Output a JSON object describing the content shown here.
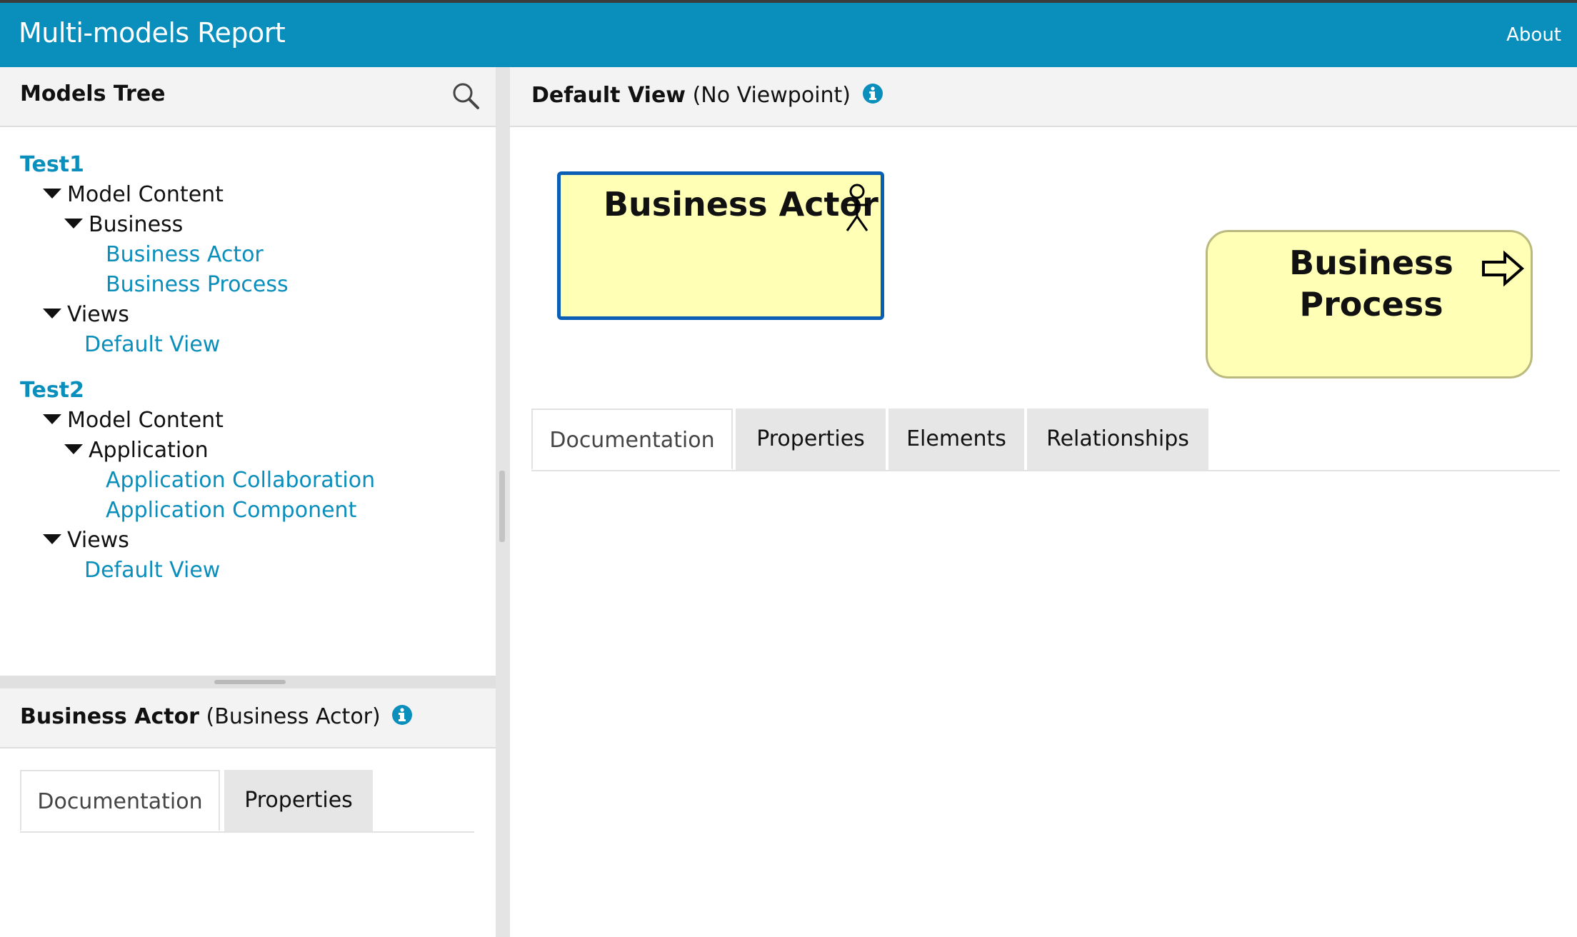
{
  "header": {
    "title": "Multi-models Report",
    "about_label": "About"
  },
  "colors": {
    "header_bg": "#0a8ebc",
    "link": "#0a8ebc",
    "element_fill": "#ffffb5",
    "selection_border": "#0a5fb4"
  },
  "models_tree": {
    "title": "Models Tree",
    "search_icon": "search-icon",
    "models": [
      {
        "name": "Test1",
        "folders": [
          {
            "label": "Model Content"
          },
          {
            "label": "Business",
            "items": [
              "Business Actor",
              "Business Process"
            ]
          },
          {
            "label": "Views",
            "items": [
              "Default View"
            ]
          }
        ]
      },
      {
        "name": "Test2",
        "folders": [
          {
            "label": "Model Content"
          },
          {
            "label": "Application",
            "items": [
              "Application Collaboration",
              "Application Component"
            ]
          },
          {
            "label": "Views",
            "items": [
              "Default View"
            ]
          }
        ]
      }
    ]
  },
  "element_detail": {
    "name": "Business Actor",
    "type": "(Business Actor)",
    "tabs": [
      "Documentation",
      "Properties"
    ],
    "active_tab": "Documentation"
  },
  "view": {
    "name": "Default View",
    "viewpoint": "(No Viewpoint)",
    "elements": [
      {
        "label": "Business Actor",
        "icon": "actor-icon",
        "selected": true
      },
      {
        "label_line1": "Business",
        "label_line2": "Process",
        "icon": "process-arrow-icon"
      }
    ],
    "tabs": [
      "Documentation",
      "Properties",
      "Elements",
      "Relationships"
    ],
    "active_tab": "Documentation"
  }
}
